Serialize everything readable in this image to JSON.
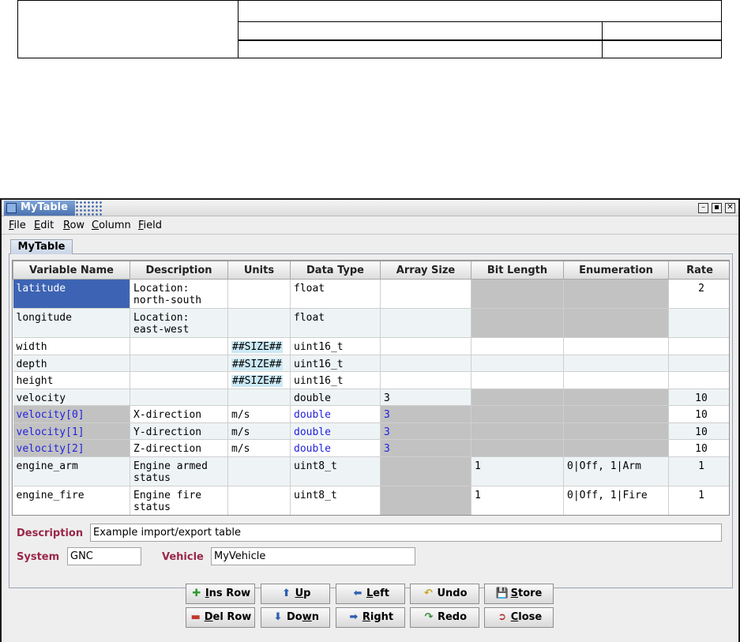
{
  "window": {
    "title": "MyTable"
  },
  "menu": [
    {
      "mnemonic": "F",
      "rest": "ile"
    },
    {
      "mnemonic": "E",
      "rest": "dit"
    },
    {
      "mnemonic": "R",
      "rest": "ow"
    },
    {
      "mnemonic": "C",
      "rest": "olumn"
    },
    {
      "mnemonic": "F",
      "rest": "ield"
    }
  ],
  "tab": {
    "label": "MyTable"
  },
  "table": {
    "headers": [
      "Variable Name",
      "Description",
      "Units",
      "Data Type",
      "Array Size",
      "Bit Length",
      "Enumeration",
      "Rate"
    ],
    "rows": [
      {
        "c0": "latitude",
        "c1": "Location:\nnorth-south",
        "c2": "",
        "c3": "float",
        "c4": "",
        "c5": "",
        "c6": "",
        "c7": "2"
      },
      {
        "c0": "longitude",
        "c1": "Location:\neast-west",
        "c2": "",
        "c3": "float",
        "c4": "",
        "c5": "",
        "c6": "",
        "c7": ""
      },
      {
        "c0": "width",
        "c1": "",
        "c2": "##SIZE##",
        "c3": "uint16_t",
        "c4": "",
        "c5": "",
        "c6": "",
        "c7": ""
      },
      {
        "c0": "depth",
        "c1": "",
        "c2": "##SIZE##",
        "c3": "uint16_t",
        "c4": "",
        "c5": "",
        "c6": "",
        "c7": ""
      },
      {
        "c0": "height",
        "c1": "",
        "c2": "##SIZE##",
        "c3": "uint16_t",
        "c4": "",
        "c5": "",
        "c6": "",
        "c7": ""
      },
      {
        "c0": "velocity",
        "c1": "",
        "c2": "",
        "c3": "double",
        "c4": "3",
        "c5": "",
        "c6": "",
        "c7": "10"
      },
      {
        "c0": "velocity[0]",
        "c1": "X-direction",
        "c2": "m/s",
        "c3": "double",
        "c4": "3",
        "c5": "",
        "c6": "",
        "c7": "10"
      },
      {
        "c0": "velocity[1]",
        "c1": "Y-direction",
        "c2": "m/s",
        "c3": "double",
        "c4": "3",
        "c5": "",
        "c6": "",
        "c7": "10"
      },
      {
        "c0": "velocity[2]",
        "c1": "Z-direction",
        "c2": "m/s",
        "c3": "double",
        "c4": "3",
        "c5": "",
        "c6": "",
        "c7": "10"
      },
      {
        "c0": "engine_arm",
        "c1": "Engine armed\nstatus",
        "c2": "",
        "c3": "uint8_t",
        "c4": "",
        "c5": "1",
        "c6": "0|Off, 1|Arm",
        "c7": "1"
      },
      {
        "c0": "engine_fire",
        "c1": "Engine fire\nstatus",
        "c2": "",
        "c3": "uint8_t",
        "c4": "",
        "c5": "1",
        "c6": "0|Off, 1|Fire",
        "c7": "1"
      }
    ]
  },
  "fields": {
    "description_label": "Description",
    "description_value": "Example import/export table",
    "system_label": "System",
    "system_value": "GNC",
    "vehicle_label": "Vehicle",
    "vehicle_value": "MyVehicle"
  },
  "buttons": {
    "ins_row": {
      "mn": "I",
      "rest": "ns Row"
    },
    "up": {
      "mn": "U",
      "rest": "p"
    },
    "left": {
      "mn": "L",
      "rest": "eft"
    },
    "undo": {
      "mn": "",
      "rest": "Undo"
    },
    "store": {
      "mn": "S",
      "rest": "tore"
    },
    "del_row": {
      "mn": "D",
      "rest": "el Row"
    },
    "down": {
      "pre": "Do",
      "mn": "w",
      "rest": "n"
    },
    "right": {
      "mn": "R",
      "rest": "ight"
    },
    "redo": {
      "mn": "",
      "rest": "Redo"
    },
    "close": {
      "mn": "C",
      "rest": "lose"
    }
  },
  "colors": {
    "selected_cell": "#3d64b4",
    "expanded_array_text": "#2222dd",
    "field_label": "#9a2749",
    "inactive_cell": "#c2c2c2",
    "macro_highlight": "#cbe9f6"
  }
}
